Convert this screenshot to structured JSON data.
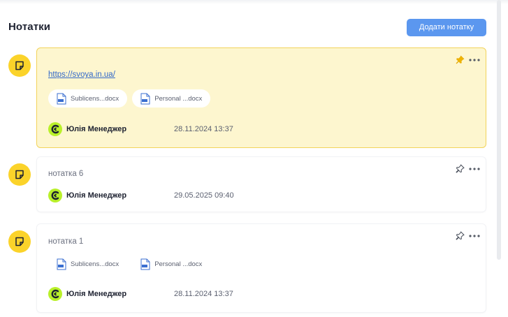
{
  "header": {
    "title": "Нотатки",
    "add_button": "Додати нотатку"
  },
  "colors": {
    "accent": "#5b97ef",
    "note_icon": "#fbd32a",
    "pinned_bg": "#fdf6cf",
    "pinned_border": "#f2d35a",
    "avatar": "#b9f02a"
  },
  "notes": [
    {
      "pinned": true,
      "link": "https://svoya.in.ua/",
      "files": [
        "Sublicens...docx",
        "Personal ...docx"
      ],
      "author": "Юлія Менеджер",
      "date": "28.11.2024 13:37"
    },
    {
      "pinned": false,
      "text": "нотатка 6",
      "author": "Юлія Менеджер",
      "date": "29.05.2025 09:40"
    },
    {
      "pinned": false,
      "text": "нотатка 1",
      "files": [
        "Sublicens...docx",
        "Personal ...docx"
      ],
      "author": "Юлія Менеджер",
      "date": "28.11.2024 13:37"
    }
  ]
}
